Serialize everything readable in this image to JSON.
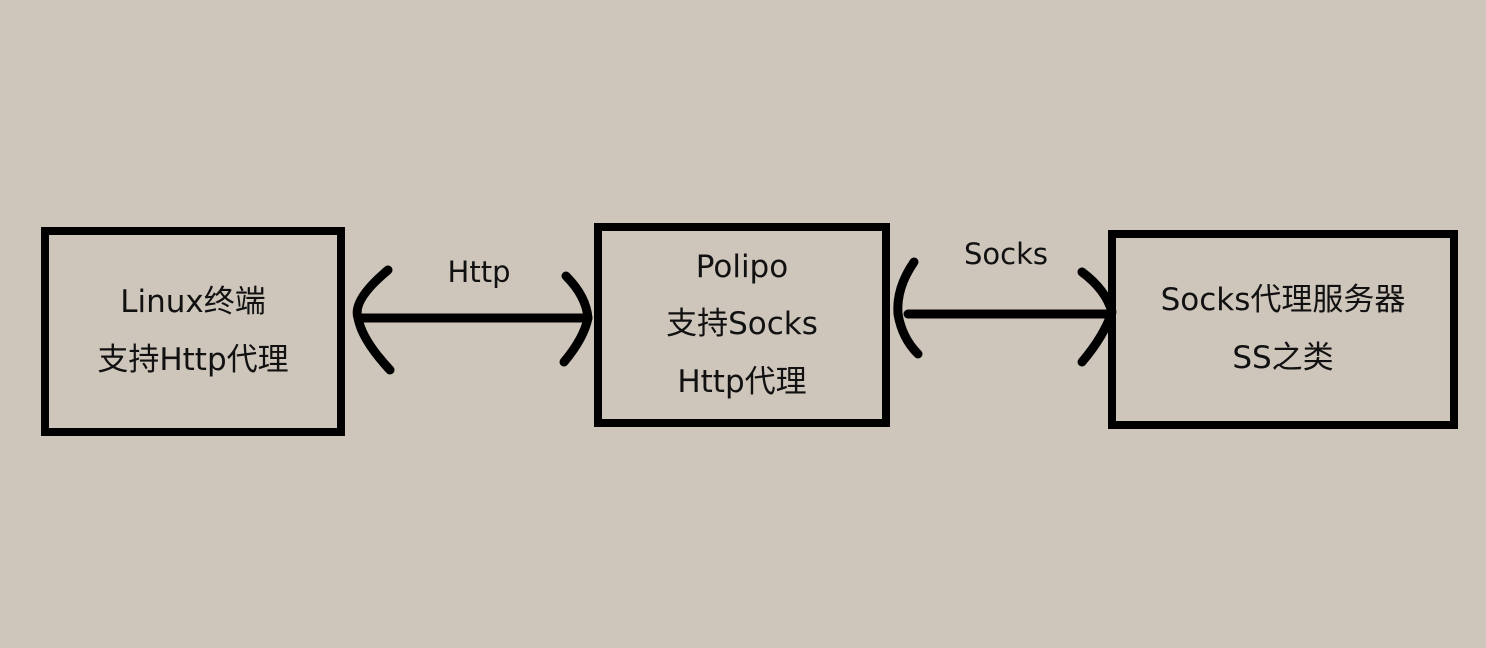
{
  "diagram": {
    "nodes": [
      {
        "id": "linux",
        "lines": [
          "Linux终端",
          "支持Http代理"
        ]
      },
      {
        "id": "polipo",
        "lines": [
          "Polipo",
          "支持Socks",
          "Http代理"
        ]
      },
      {
        "id": "socks-server",
        "lines": [
          "Socks代理服务器",
          "SS之类"
        ]
      }
    ],
    "edges": [
      {
        "from": "linux",
        "to": "polipo",
        "label": "Http",
        "direction": "both"
      },
      {
        "from": "polipo",
        "to": "socks-server",
        "label": "Socks",
        "direction": "both"
      }
    ],
    "colors": {
      "background": "#CEC5BB",
      "stroke": "#000000",
      "text": "#111111"
    }
  }
}
